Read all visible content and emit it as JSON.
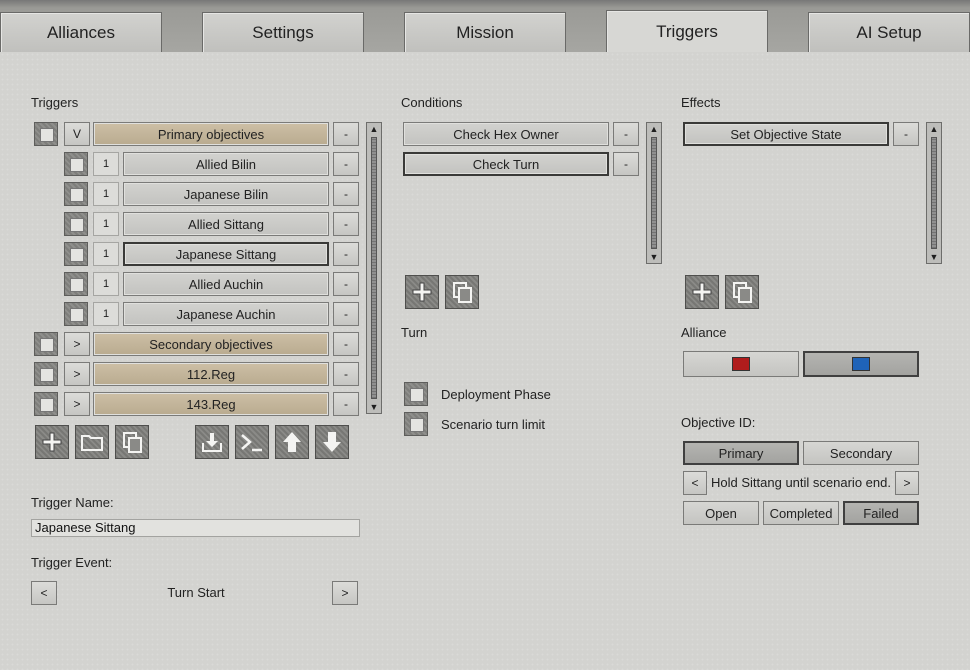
{
  "tabs": [
    {
      "label": "Alliances",
      "active": false
    },
    {
      "label": "Settings",
      "active": false
    },
    {
      "label": "Mission",
      "active": false
    },
    {
      "label": "Triggers",
      "active": true
    },
    {
      "label": "AI Setup",
      "active": false
    }
  ],
  "triggers": {
    "heading": "Triggers",
    "expand_open": "V",
    "expand_closed": ">",
    "remove": "-",
    "rows": [
      {
        "label": "Primary objectives",
        "type": "group",
        "toggle": "V"
      },
      {
        "label": "Allied Bilin",
        "type": "item",
        "num": "1"
      },
      {
        "label": "Japanese Bilin",
        "type": "item",
        "num": "1"
      },
      {
        "label": "Allied Sittang",
        "type": "item",
        "num": "1"
      },
      {
        "label": "Japanese Sittang",
        "type": "item",
        "num": "1",
        "selected": true
      },
      {
        "label": "Allied Auchin",
        "type": "item",
        "num": "1"
      },
      {
        "label": "Japanese Auchin",
        "type": "item",
        "num": "1"
      },
      {
        "label": "Secondary objectives",
        "type": "group",
        "toggle": ">"
      },
      {
        "label": "112.Reg",
        "type": "group",
        "toggle": ">"
      },
      {
        "label": "143.Reg",
        "type": "group",
        "toggle": ">"
      }
    ],
    "toolbar_icons": [
      "add-icon",
      "folder-icon",
      "copy-icon",
      "download-icon",
      "terminal-icon",
      "move-up-icon",
      "move-down-icon"
    ]
  },
  "trigger_name": {
    "label": "Trigger Name:",
    "value": "Japanese Sittang"
  },
  "trigger_event": {
    "label": "Trigger Event:",
    "value": "Turn Start",
    "prev": "<",
    "next": ">"
  },
  "conditions": {
    "heading": "Conditions",
    "rows": [
      "Check Hex Owner",
      "Check Turn"
    ],
    "remove": "-"
  },
  "effects": {
    "heading": "Effects",
    "rows": [
      "Set Objective State"
    ],
    "remove": "-"
  },
  "turn": {
    "heading": "Turn",
    "options": [
      "Deployment Phase",
      "Scenario turn limit"
    ]
  },
  "alliance": {
    "heading": "Alliance",
    "colors": [
      "#b01c1c",
      "#1f63b8"
    ]
  },
  "objective": {
    "heading": "Objective ID:",
    "types": [
      "Primary",
      "Secondary"
    ],
    "selected_type": "Primary",
    "current": "Hold Sittang until scenario end.",
    "prev": "<",
    "next": ">",
    "states": [
      "Open",
      "Completed",
      "Failed"
    ],
    "selected_state": "Failed"
  }
}
